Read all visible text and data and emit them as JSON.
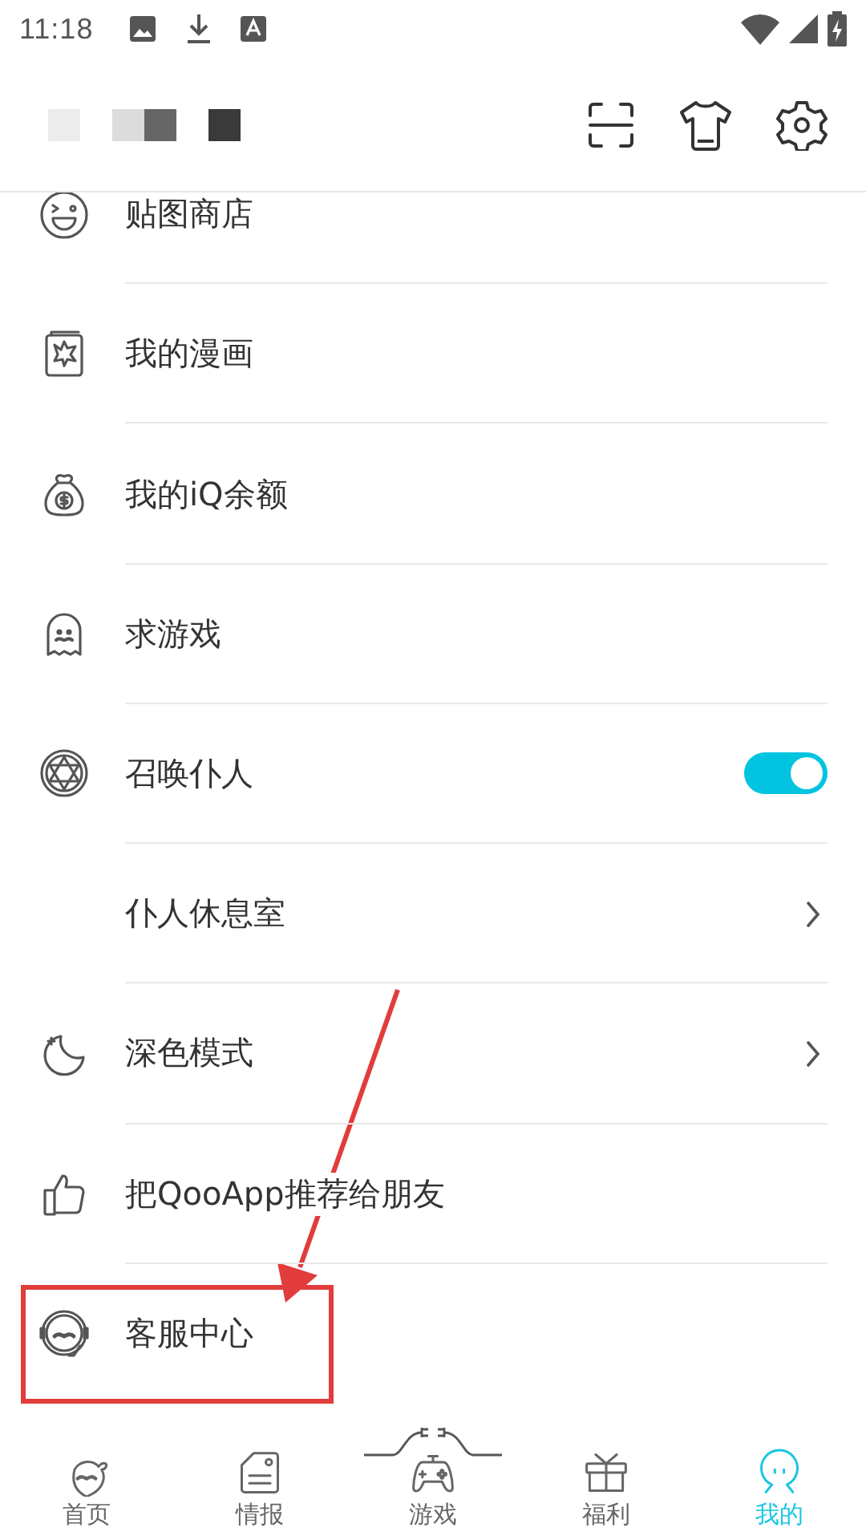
{
  "status_bar": {
    "time": "11:18"
  },
  "menu": [
    {
      "label": "贴图商店",
      "kind": "plain"
    },
    {
      "label": "我的漫画",
      "kind": "plain"
    },
    {
      "label": "我的iQ余额",
      "kind": "plain"
    },
    {
      "label": "求游戏",
      "kind": "plain"
    },
    {
      "label": "召唤仆人",
      "kind": "toggle",
      "on": true
    },
    {
      "label": "仆人休息室",
      "kind": "link"
    },
    {
      "label": "深色模式",
      "kind": "link"
    },
    {
      "label": "把QooApp推荐给朋友",
      "kind": "plain"
    },
    {
      "label": "客服中心",
      "kind": "plain"
    }
  ],
  "bottom_nav": [
    {
      "label": "首页",
      "selected": false
    },
    {
      "label": "情报",
      "selected": false
    },
    {
      "label": "游戏",
      "selected": false
    },
    {
      "label": "福利",
      "selected": false
    },
    {
      "label": "我的",
      "selected": true
    }
  ]
}
